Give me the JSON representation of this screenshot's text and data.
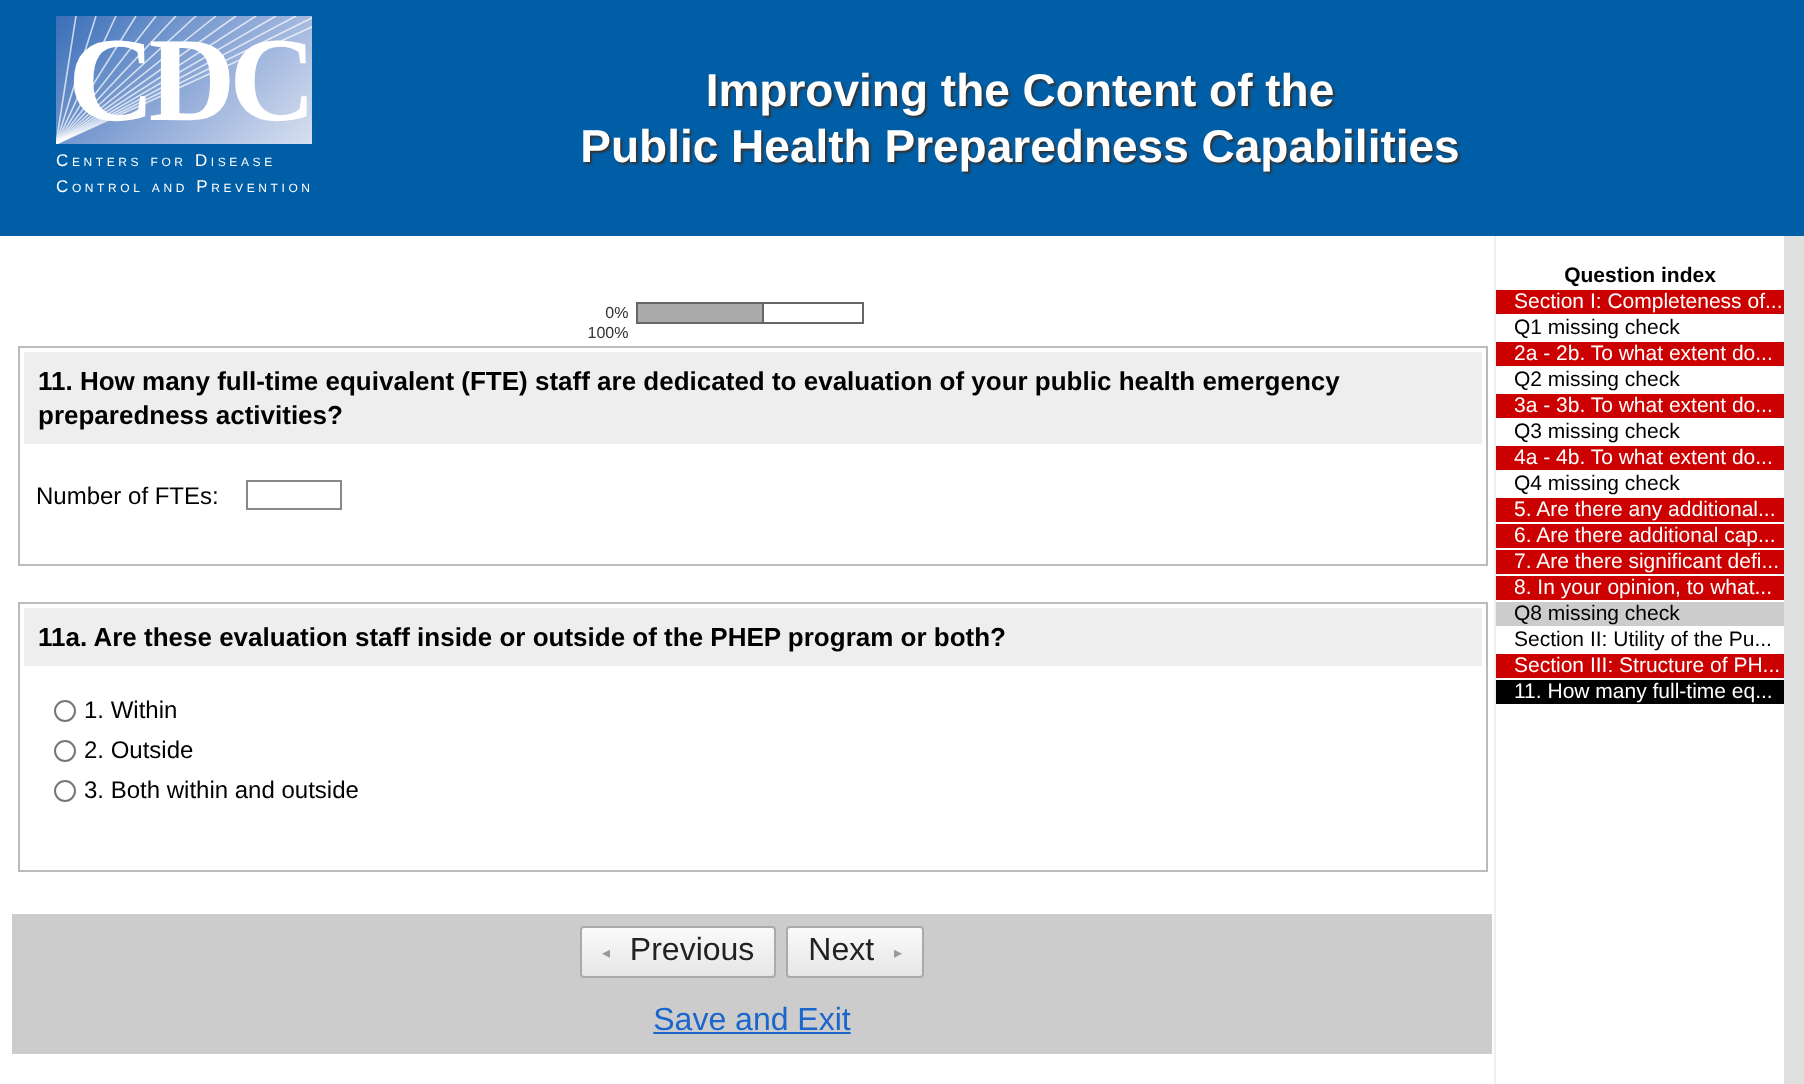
{
  "header": {
    "logo_letters": "CDC",
    "logo_subtitle_1": "Centers for Disease",
    "logo_subtitle_2": "Control and Prevention",
    "title_line_1": "Improving the Content of the",
    "title_line_2": "Public Health Preparedness Capabilities"
  },
  "progress": {
    "start_label": "0%",
    "end_label": "100%",
    "level": 0.55
  },
  "questions": [
    {
      "kind": "number",
      "title": "11. How many full-time equivalent (FTE) staff are dedicated to evaluation of your public health emergency preparedness activities?",
      "field_label": "Number of FTEs:"
    },
    {
      "kind": "radio",
      "title": "11a. Are these evaluation staff inside or outside of the PHEP program or both?",
      "options": [
        {
          "label": "1. Within",
          "selected": false
        },
        {
          "label": "2. Outside",
          "selected": false
        },
        {
          "label": "3. Both within and outside",
          "selected": false
        }
      ]
    }
  ],
  "navigation": {
    "previous": "Previous",
    "next": "Next",
    "save_link": "Save and Exit",
    "previous_arrow": "◂",
    "next_arrow": "▸"
  },
  "question_index": {
    "title": "Question index",
    "items": [
      {
        "label": "Section I: Completeness of...",
        "color": "#cc0000"
      },
      {
        "label": "Q1 missing check",
        "color": "#ffffff"
      },
      {
        "label": "2a - 2b. To what extent do...",
        "color": "#cc0000"
      },
      {
        "label": "Q2 missing check",
        "color": "#ffffff"
      },
      {
        "label": "3a - 3b. To what extent do...",
        "color": "#cc0000"
      },
      {
        "label": "Q3 missing check",
        "color": "#ffffff"
      },
      {
        "label": "4a - 4b. To what extent do...",
        "color": "#cc0000"
      },
      {
        "label": "Q4 missing check",
        "color": "#ffffff"
      },
      {
        "label": "5. Are there any additional...",
        "color": "#cc0000"
      },
      {
        "label": "6. Are there additional cap...",
        "color": "#cc0000"
      },
      {
        "label": "7. Are there significant defi...",
        "color": "#cc0000"
      },
      {
        "label": "8. In your opinion, to what...",
        "color": "#cc0000"
      },
      {
        "label": "Q8 missing check",
        "color": "#cccccc"
      },
      {
        "label": "Section II: Utility of the Pu...",
        "color": "#ffffff"
      },
      {
        "label": "Section III: Structure of PH...",
        "color": "#cc0000"
      },
      {
        "label": "11. How many full-time eq...",
        "color": "#000000"
      }
    ]
  }
}
